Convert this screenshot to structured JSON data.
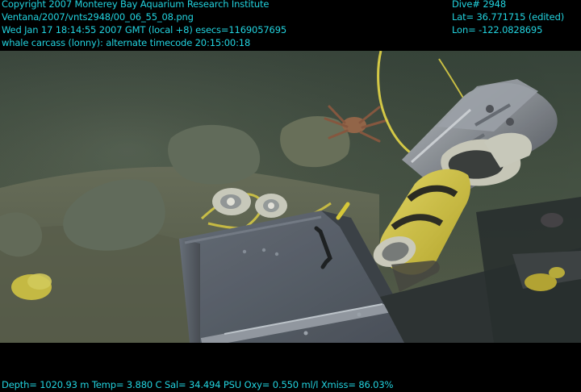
{
  "overlay": {
    "copyright": "Copyright 2007 Monterey Bay Aquarium Research Institute",
    "path": "Ventana/2007/vnts2948/00_06_55_08.png",
    "timestamp": "Wed Jan 17 18:14:55 2007 GMT (local +8)  esecs=1169057695",
    "annotation": "whale carcass (lonny): alternate timecode 20:15:00:18",
    "dive": "Dive# 2948",
    "lat": "Lat= 36.771715 (edited)",
    "lon": "Lon= -122.0828695",
    "telemetry": "Depth= 1020.93 m  Temp= 3.880 C  Sal= 34.494 PSU  Oxy= 0.550 ml/l  Xmiss= 86.03%"
  },
  "colors": {
    "overlay_text": "#22d3df",
    "water": "#4f5c4a",
    "sediment": "#666c58",
    "metal_panel": "#59606c",
    "yellow": "#e3d54a"
  }
}
